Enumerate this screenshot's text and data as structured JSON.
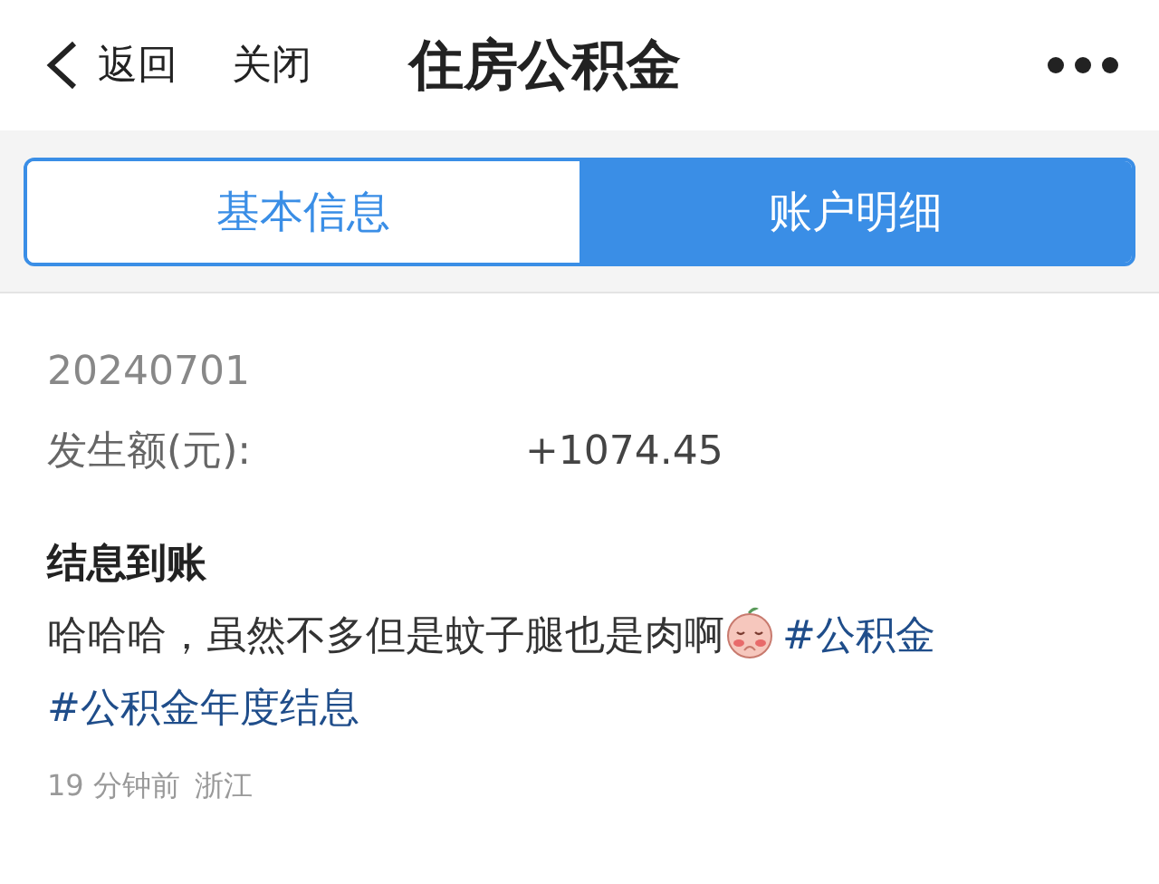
{
  "nav": {
    "back": "返回",
    "close": "关闭",
    "title": "住房公积金"
  },
  "tabs": [
    {
      "label": "基本信息",
      "selected": false
    },
    {
      "label": "账户明细",
      "selected": true
    }
  ],
  "record": {
    "date": "20240701",
    "amount_label": "发生额(元):",
    "amount": "+1074.45"
  },
  "post": {
    "title": "结息到账",
    "segments": [
      {
        "kind": "text",
        "text": "哈哈哈，虽然不多但是蚊子腿也是肉啊"
      },
      {
        "kind": "emoji"
      },
      {
        "kind": "hashtag",
        "text": "#公积金"
      },
      {
        "kind": "hashtag",
        "text": "#公积金年度结息"
      }
    ],
    "time": "19 分钟前",
    "location": "浙江"
  }
}
